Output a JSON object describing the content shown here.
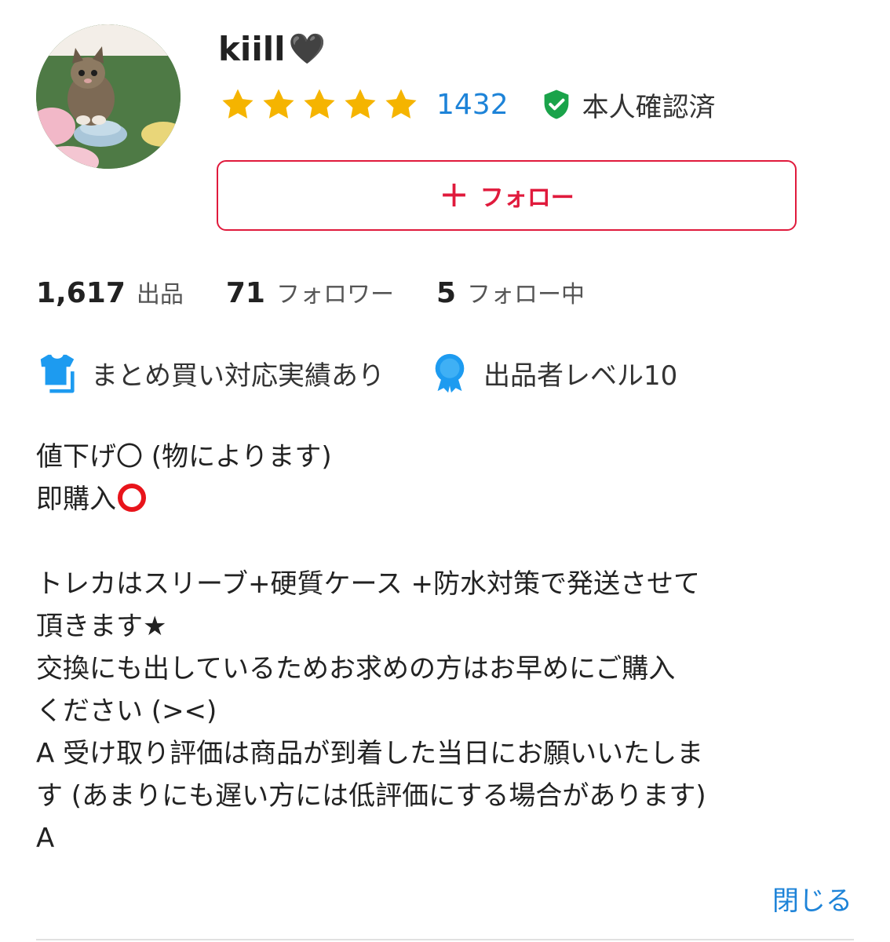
{
  "profile": {
    "username": "kiill",
    "heart": "🖤",
    "avatar_icon": "kitten-photo",
    "rating_stars": 5,
    "rating_count": "1432",
    "verified_label": "本人確認済",
    "follow_label": "フォロー",
    "follow_icon": "+"
  },
  "stats": [
    {
      "value": "1,617",
      "label": "出品"
    },
    {
      "value": "71",
      "label": "フォロワー"
    },
    {
      "value": "5",
      "label": "フォロー中"
    }
  ],
  "badges": [
    {
      "icon": "shirt-stack-icon",
      "label": "まとめ買い対応実績あり"
    },
    {
      "icon": "medal-icon",
      "label": "出品者レベル10"
    }
  ],
  "bio": {
    "line1": "値下げ〇 (物によります)",
    "line2": "即購入",
    "line3": "トレカはスリーブ+硬質ケース +防水対策で発送させて",
    "line4": "頂きます★",
    "line5": "交換にも出しているためお求めの方はお早めにご購入",
    "line6": "ください (><)",
    "line7": "A 受け取り評価は商品が到着した当日にお願いいたしま",
    "line8": "す (あまりにも遅い方には低評価にする場合があります)",
    "line9": "A"
  },
  "close_label": "閉じる",
  "colors": {
    "accent_red": "#e01a3c",
    "link_blue": "#1d83d8",
    "star_yellow": "#f5b400",
    "verified_green": "#1aa34a",
    "badge_blue": "#1d9bf0"
  }
}
